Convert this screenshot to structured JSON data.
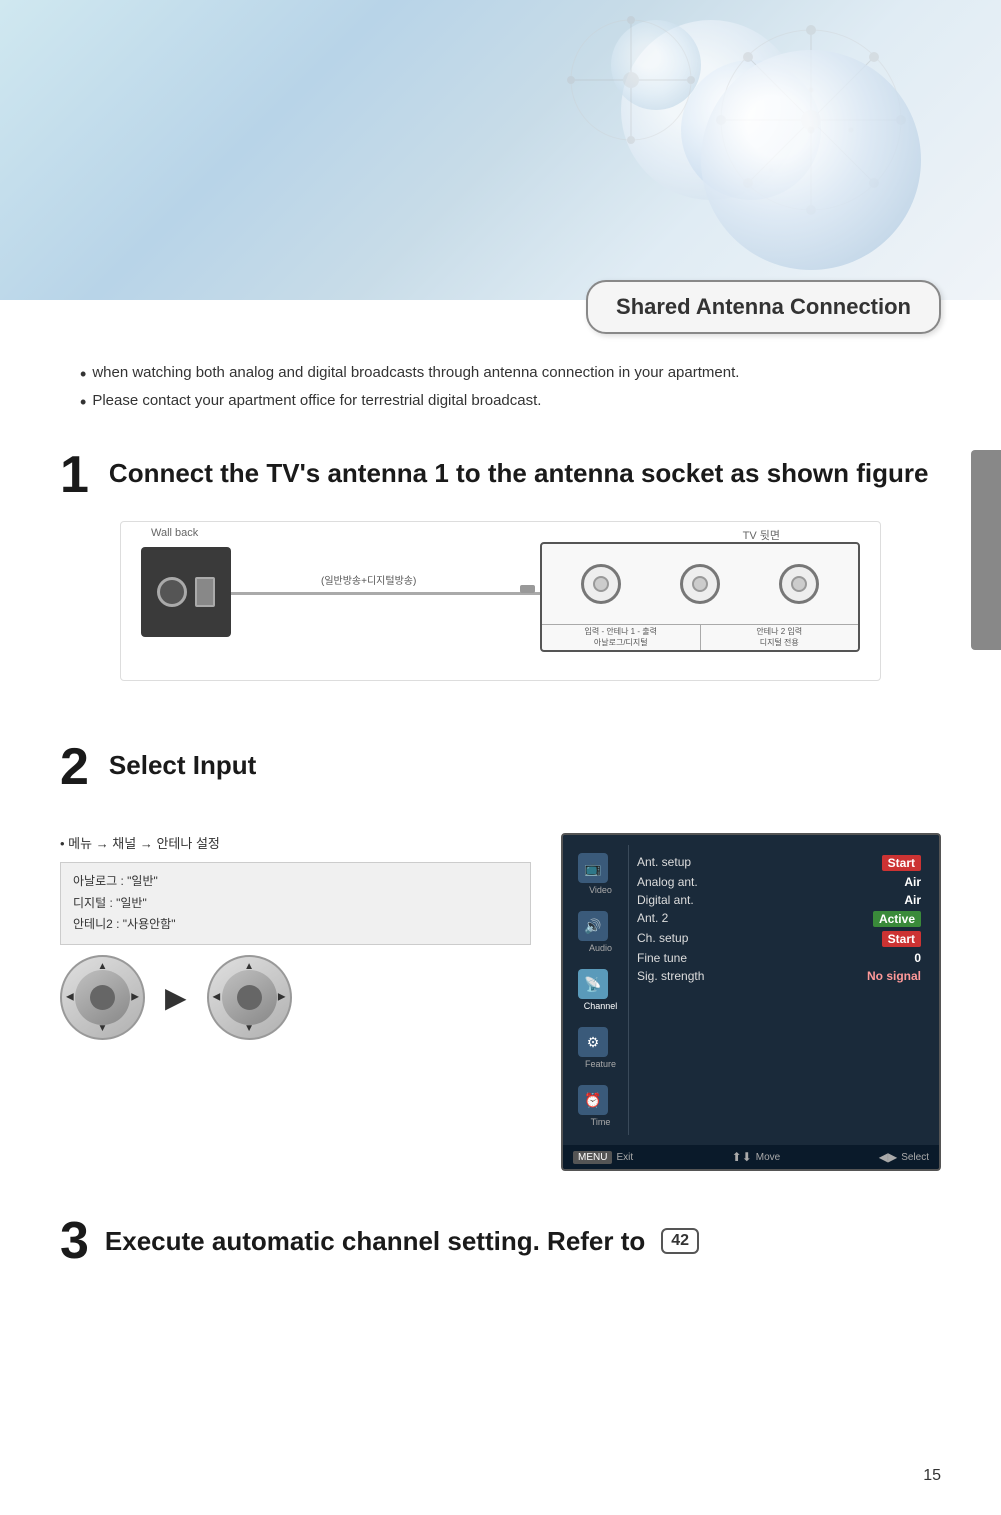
{
  "page": {
    "number": "15"
  },
  "header": {
    "badge_text": "Shared Antenna Connection"
  },
  "bullets": [
    "when watching both analog and digital broadcasts through antenna connection in your apartment.",
    "Please contact your apartment office for terrestrial digital broadcast."
  ],
  "step1": {
    "number": "1",
    "title": "Connect the TV's antenna 1 to the antenna socket as shown figure",
    "wall_label": "Wall back",
    "tv_label": "TV 뒷면",
    "cable_label": "(일반방송+디지털방송)",
    "port1_label1": "입력 - 안테나 1 - 출력",
    "port1_label2": "아날로그/디지털",
    "port2_label1": "안테나 2 입력",
    "port2_label2": "디지털 전용"
  },
  "step2": {
    "number": "2",
    "title": "Select Input",
    "menu_path": "• 메뉴 → 채널 → 안테나 설정",
    "settings": [
      "아날로그 : \"일반\"",
      "디지털    : \"일반\"",
      "안테니2  : \"사용안함\""
    ],
    "menu_items": [
      {
        "name": "Ant. setup",
        "value": "Start",
        "style": "highlight"
      },
      {
        "name": "Analog ant.",
        "value": "Air",
        "style": "normal"
      },
      {
        "name": "Digital ant.",
        "value": "Air",
        "style": "normal"
      },
      {
        "name": "Ant. 2",
        "value": "Active",
        "style": "active"
      },
      {
        "name": "Ch. setup",
        "value": "Start",
        "style": "highlight"
      },
      {
        "name": "Fine tune",
        "value": "0",
        "style": "normal"
      },
      {
        "name": "Sig. strength",
        "value": "No signal",
        "style": "normal"
      }
    ],
    "sidebar_items": [
      "Video",
      "Audio",
      "Channel",
      "Feature",
      "Time"
    ],
    "bottom_bar": {
      "menu_label": "MENU",
      "exit_label": "Exit",
      "move_label": "Move",
      "select_label": "Select"
    }
  },
  "step3": {
    "number": "3",
    "text": "Execute automatic channel setting. Refer to",
    "page_ref": "42"
  },
  "icons": {
    "arrow_right": "▶",
    "bullet": "•",
    "up": "▲",
    "down": "▼",
    "left": "◀",
    "right_arrow": "▶"
  }
}
